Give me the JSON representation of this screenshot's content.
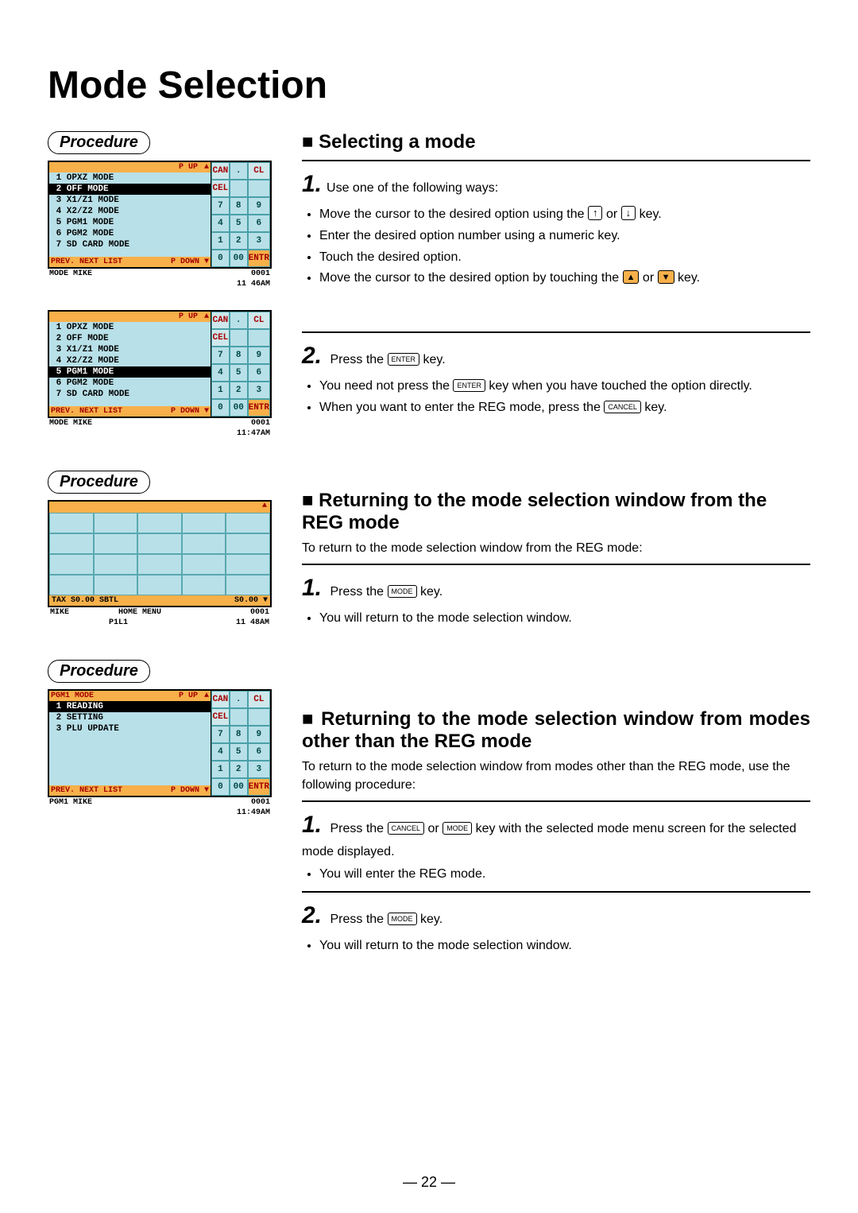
{
  "page_title": "Mode Selection",
  "page_number": "— 22 —",
  "procedure_label": "Procedure",
  "sections": {
    "s1": {
      "heading": "Selecting a mode",
      "step1_lead": "Use one of the following ways:",
      "bullets1": [
        "Move the cursor to the desired option using the",
        "or",
        "key.",
        "Enter the desired option number using a numeric key.",
        "Touch the desired option.",
        "Move the cursor to the desired option by touching the",
        "or",
        "key."
      ],
      "step2_lead": "Press the",
      "step2_tail": "key.",
      "bullets2_a": "You need not press the",
      "bullets2_b": "key when you have touched the option directly.",
      "bullets2_c": "When you want to enter the REG mode, press the",
      "bullets2_d": "key."
    },
    "s2": {
      "heading": "Returning to the mode selection window from the REG mode",
      "lead": "To return to the mode selection window from the REG mode:",
      "step1_lead": "Press the",
      "step1_tail": "key.",
      "bullet": "You will return to the mode selection window."
    },
    "s3": {
      "heading": "Returning to the mode selection window from modes other than the REG mode",
      "lead": "To return to the mode selection window from modes other than the REG mode, use the following procedure:",
      "step1_a": "Press the",
      "step1_b": "or",
      "step1_c": "key with the selected mode menu screen for the selected mode displayed.",
      "bullet1": "You will enter the REG mode.",
      "step2_lead": "Press the",
      "step2_tail": "key.",
      "bullet2": "You will return to the mode selection window."
    }
  },
  "keys": {
    "up": "↑",
    "down": "↓",
    "tri_up": "▲",
    "tri_down": "▼",
    "enter": "ENTER",
    "cancel": "CANCEL",
    "mode": "MODE"
  },
  "shots": {
    "shot1": {
      "pup": "P UP",
      "tri": "▲",
      "rows": [
        "1 OPXZ MODE",
        "2 OFF MODE",
        "3 X1/Z1 MODE",
        "4 X2/Z2 MODE",
        "5 PGM1 MODE",
        "6 PGM2 MODE",
        "7 SD CARD MODE"
      ],
      "selected": 1,
      "nav": [
        "PREV.",
        "NEXT",
        "LIST",
        "P DOWN ▼"
      ],
      "status_l": "MODE   MIKE",
      "status_r": "0001",
      "time": "11 46AM"
    },
    "shot2": {
      "pup": "P UP",
      "tri": "▲",
      "rows": [
        "1 OPXZ MODE",
        "2 OFF MODE",
        "3 X1/Z1 MODE",
        "4 X2/Z2 MODE",
        "5 PGM1 MODE",
        "6 PGM2 MODE",
        "7 SD CARD MODE"
      ],
      "selected": 4,
      "nav": [
        "PREV.",
        "NEXT",
        "LIST",
        "P DOWN ▼"
      ],
      "status_l": "MODE   MIKE",
      "status_r": "0001",
      "time": "11:47AM"
    },
    "shot3": {
      "tri": "▲",
      "tax_l": "TAX S0.00 SBTL",
      "tax_r": "S0.00 ▼",
      "stat_name": "MIKE",
      "stat_mid": "HOME MENU",
      "stat_r": "0001",
      "stat2_mid": "P1L1",
      "stat2_r": "11 48AM"
    },
    "shot4": {
      "title": "PGM1 MODE",
      "pup": "P UP",
      "tri": "▲",
      "rows": [
        "1 READING",
        "2 SETTING",
        "3 PLU UPDATE"
      ],
      "selected": 0,
      "nav": [
        "PREV.",
        "NEXT",
        "LIST",
        "P DOWN ▼"
      ],
      "status_l": "PGM1   MIKE",
      "status_r": "0001",
      "time": "11:49AM"
    },
    "keypad": [
      "CAN",
      "CEL",
      ".",
      "CL",
      "7",
      "8",
      "9",
      "4",
      "5",
      "6",
      "1",
      "2",
      "3",
      "0",
      "00",
      "ENTR"
    ]
  }
}
